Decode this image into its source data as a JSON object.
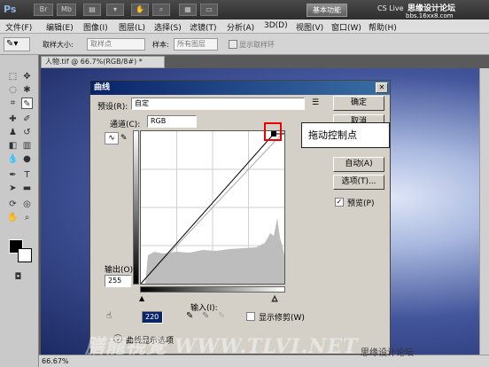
{
  "app": {
    "logo": "Ps",
    "basic_functions": "基本功能",
    "cs_live": "CS Live",
    "site_title": "思缘设计论坛",
    "site_url": "bbs.16xx8.com"
  },
  "menu": [
    "文件(F)",
    "编辑(E)",
    "图像(I)",
    "图层(L)",
    "选择(S)",
    "滤镜(T)",
    "分析(A)",
    "3D(D)",
    "视图(V)",
    "窗口(W)",
    "帮助(H)"
  ],
  "options": {
    "sample_size_label": "取样大小:",
    "sample_size_value": "取样点",
    "sample_label": "样本:",
    "sample_value": "所有图层",
    "show_ring": "显示取样环"
  },
  "document": {
    "tab": "人物.tif @ 66.7%(RGB/8#) *",
    "zoom": "66.67%"
  },
  "dialog": {
    "title": "曲线",
    "preset_label": "预设(R):",
    "preset_value": "自定",
    "ok": "确定",
    "cancel": "取消",
    "channel_label": "通道(C):",
    "channel_value": "RGB",
    "auto": "自动(A)",
    "options": "选项(T)...",
    "preview": "预览(P)",
    "output_label": "输出(O):",
    "output_value": "255",
    "input_label": "输入(I):",
    "input_value": "220",
    "show_clipping": "显示修剪(W)",
    "curve_display": "曲线显示选项"
  },
  "callout": "拖动控制点",
  "watermark": {
    "main": "膳龍視覺 WWW.TLVI.NET",
    "credit": "思缘设计论坛"
  }
}
